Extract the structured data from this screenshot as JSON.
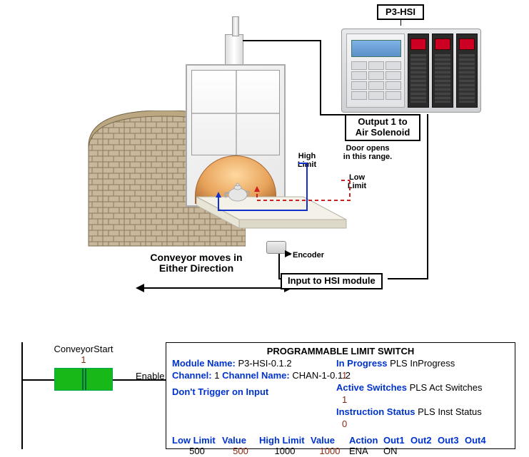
{
  "plc": {
    "tag": "P3-HSI"
  },
  "labels": {
    "output": "Output 1 to\nAir Solenoid",
    "high_limit": "High\nLimit",
    "low_limit": "Low\nLimit",
    "door_opens": "Door opens\nin this range.",
    "encoder": "Encoder",
    "conveyor": "Conveyor moves in\nEither Direction",
    "input": "Input to HSI module"
  },
  "ladder": {
    "contact_name": "ConveyorStart",
    "contact_state": "1",
    "enable": "Enable"
  },
  "pls": {
    "title": "PROGRAMMABLE LIMIT SWITCH",
    "module_name_label": "Module Name:",
    "module_name": "P3-HSI-0.1.2",
    "channel_label": "Channel:",
    "channel": "1",
    "channel_name_label": "Channel Name:",
    "channel_name": "CHAN-1-0.1.2",
    "trigger": "Don't Trigger on Input",
    "in_progress_label": "In Progress",
    "in_progress": "PLS InProgress",
    "in_progress_val": "1",
    "active_sw_label": "Active Switches",
    "active_sw": "PLS Act Switches",
    "active_sw_val": "1",
    "inst_status_label": "Instruction Status",
    "inst_status": "PLS Inst Status",
    "inst_status_val": "0",
    "headers": {
      "low_limit": "Low Limit",
      "value1": "Value",
      "high_limit": "High Limit",
      "value2": "Value",
      "action": "Action",
      "out1": "Out1",
      "out2": "Out2",
      "out3": "Out3",
      "out4": "Out4"
    },
    "row": {
      "low": "500",
      "v1": "500",
      "high": "1000",
      "v2": "1000",
      "action": "ENA",
      "out1": "ON"
    }
  }
}
